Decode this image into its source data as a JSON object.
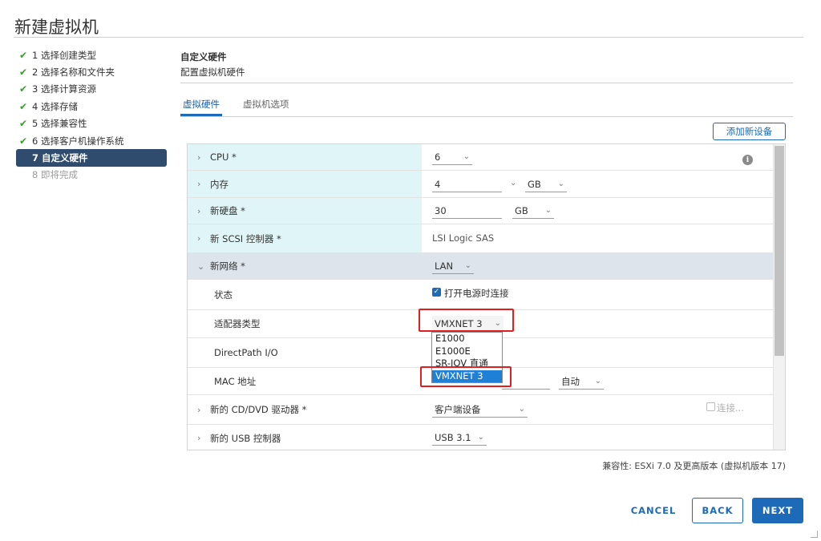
{
  "window": {
    "title": "新建虚拟机"
  },
  "steps": [
    {
      "label": "1 选择创建类型",
      "state": "done"
    },
    {
      "label": "2 选择名称和文件夹",
      "state": "done"
    },
    {
      "label": "3 选择计算资源",
      "state": "done"
    },
    {
      "label": "4 选择存储",
      "state": "done"
    },
    {
      "label": "5 选择兼容性",
      "state": "done"
    },
    {
      "label": "6 选择客户机操作系统",
      "state": "done"
    },
    {
      "label": "7 自定义硬件",
      "state": "active"
    },
    {
      "label": "8 即将完成",
      "state": "pending"
    }
  ],
  "section": {
    "title": "自定义硬件",
    "subtitle": "配置虚拟机硬件"
  },
  "tabs": [
    {
      "label": "虚拟硬件",
      "active": true
    },
    {
      "label": "虚拟机选项",
      "active": false
    }
  ],
  "add_device_label": "添加新设备",
  "rows": {
    "cpu": {
      "label": "CPU *",
      "value": "6"
    },
    "memory": {
      "label": "内存",
      "value": "4",
      "unit": "GB"
    },
    "disk": {
      "label": "新硬盘 *",
      "value": "30",
      "unit": "GB"
    },
    "scsi": {
      "label": "新 SCSI 控制器 *",
      "value": "LSI Logic SAS"
    },
    "network": {
      "label": "新网络 *",
      "value": "LAN"
    },
    "status": {
      "label": "状态",
      "checkbox_label": "打开电源时连接"
    },
    "adapter": {
      "label": "适配器类型",
      "value": "VMXNET 3"
    },
    "directpath": {
      "label": "DirectPath I/O"
    },
    "mac": {
      "label": "MAC 地址",
      "mode": "自动"
    },
    "cdrom": {
      "label": "新的 CD/DVD 驱动器 *",
      "value": "客户端设备",
      "connect_label": "连接..."
    },
    "usb": {
      "label": "新的 USB 控制器",
      "value": "USB 3.1"
    }
  },
  "adapter_options": [
    "E1000",
    "E1000E",
    "SR-IOV 直通",
    "VMXNET 3"
  ],
  "adapter_selected": "VMXNET 3",
  "compat_text": "兼容性: ESXi 7.0 及更高版本 (虚拟机版本 17)",
  "buttons": {
    "cancel": "CANCEL",
    "back": "BACK",
    "next": "NEXT"
  },
  "colors": {
    "accent": "#1d6bb8",
    "active_step": "#2f4c6e",
    "highlight_row": "#dff5f7",
    "annotation_red": "#e02020",
    "check": "#3a9d2e"
  }
}
